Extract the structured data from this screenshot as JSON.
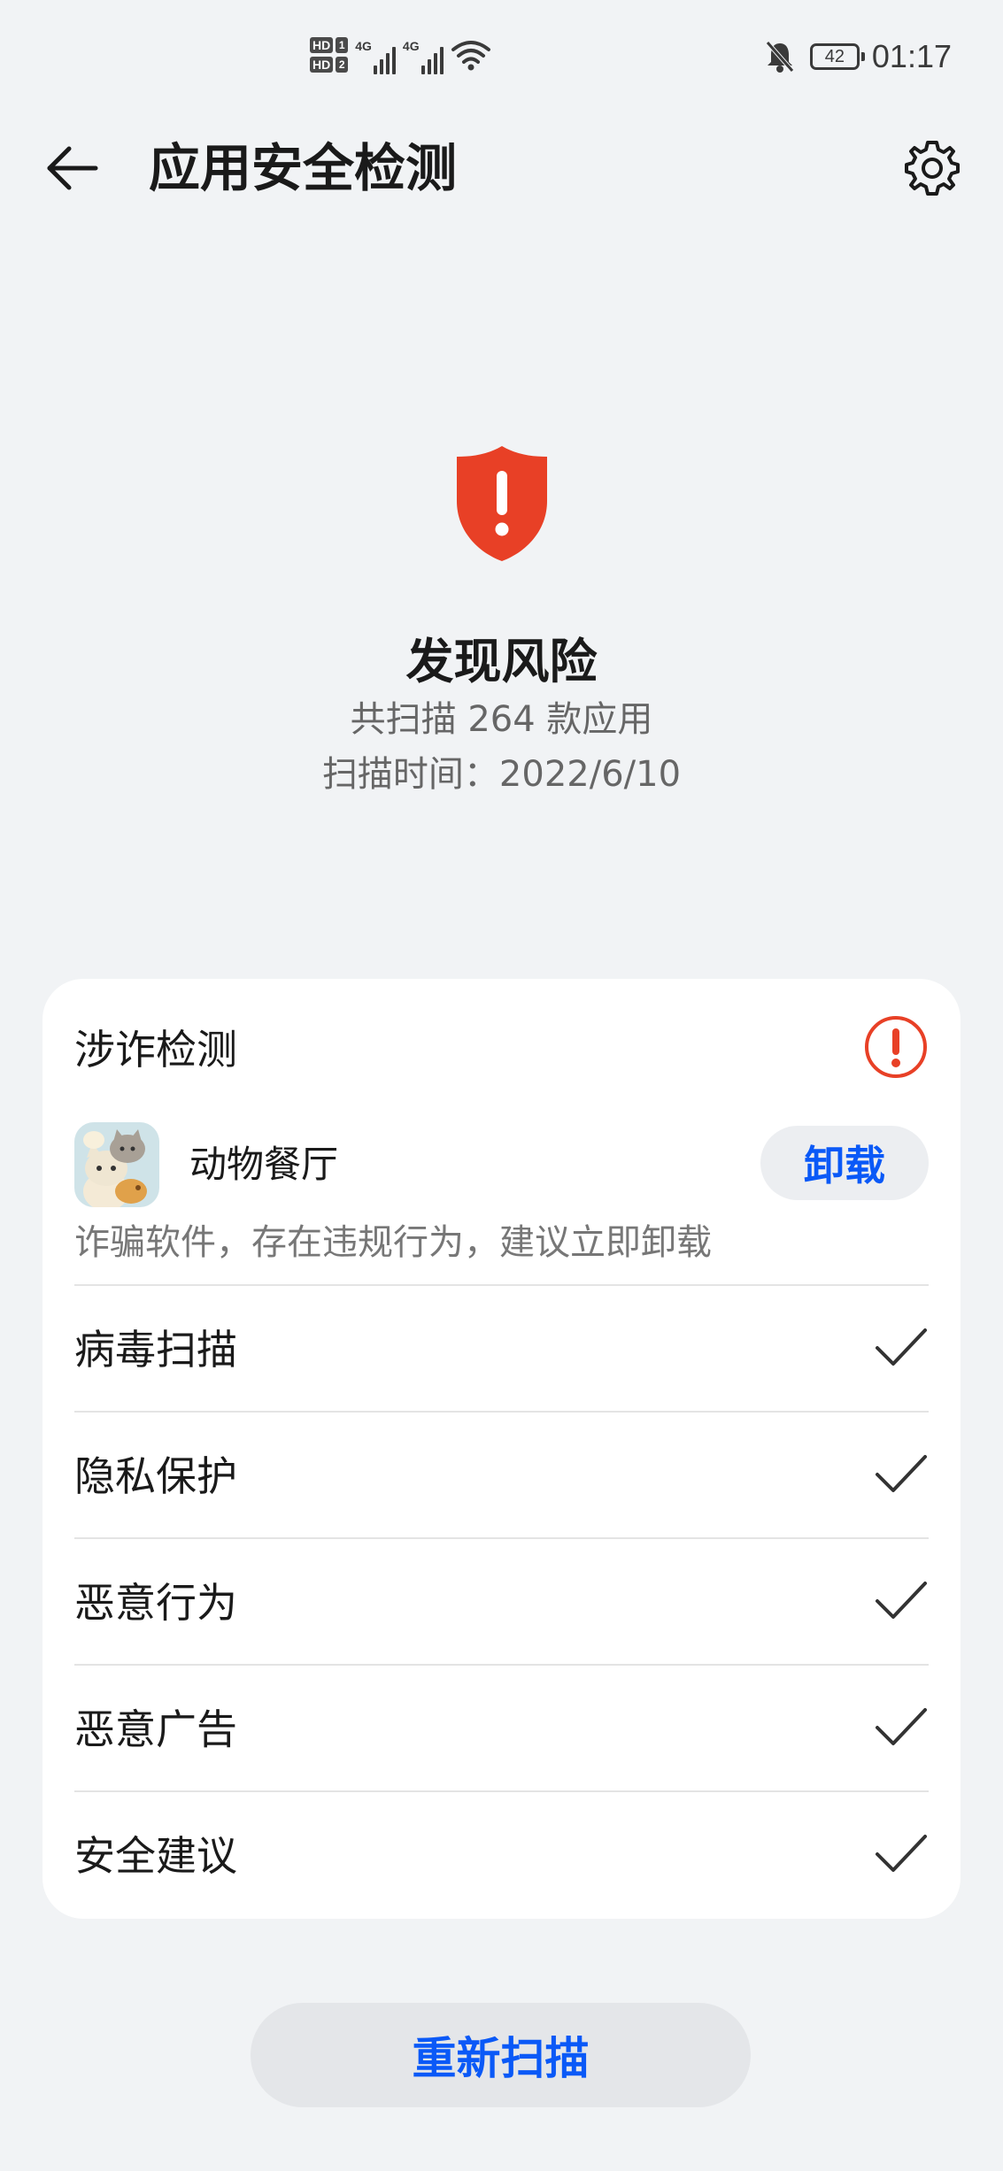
{
  "status_bar": {
    "hd1_label": "HD",
    "hd1_num": "1",
    "hd2_label": "HD",
    "hd2_num": "2",
    "sim1_network": "4G",
    "sim2_network": "4G",
    "battery_level": "42",
    "time": "01:17",
    "icons": [
      "signal-icon",
      "wifi-icon",
      "silent-bell-icon",
      "battery-icon"
    ]
  },
  "header": {
    "title": "应用安全检测",
    "back_icon": "arrow-left-icon",
    "settings_icon": "gear-icon"
  },
  "hero": {
    "icon": "shield-alert-icon",
    "status": "发现风险",
    "scan_count": "共扫描 264 款应用",
    "scan_time": "扫描时间：2022/6/10"
  },
  "fraud_section": {
    "title": "涉诈检测",
    "status_icon": "exclamation-circle-icon",
    "app": {
      "name": "动物餐厅",
      "action_label": "卸载",
      "warning": "诈骗软件，存在违规行为，建议立即卸载"
    }
  },
  "checks": [
    {
      "label": "病毒扫描",
      "status": "passed"
    },
    {
      "label": "隐私保护",
      "status": "passed"
    },
    {
      "label": "恶意行为",
      "status": "passed"
    },
    {
      "label": "恶意广告",
      "status": "passed"
    },
    {
      "label": "安全建议",
      "status": "passed"
    }
  ],
  "rescan_label": "重新扫描",
  "colors": {
    "accent": "#0a59f7",
    "danger": "#e84026",
    "background": "#f1f3f5"
  }
}
